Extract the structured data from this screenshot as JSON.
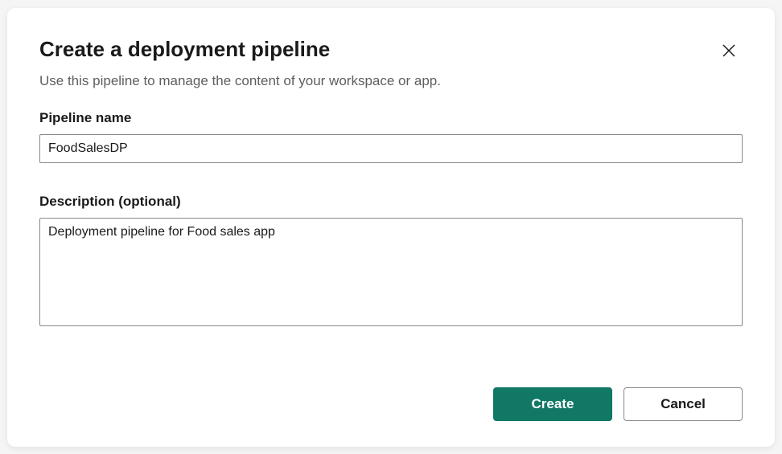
{
  "dialog": {
    "title": "Create a deployment pipeline",
    "subtitle": "Use this pipeline to manage the content of your workspace or app."
  },
  "fields": {
    "name": {
      "label": "Pipeline name",
      "value": "FoodSalesDP"
    },
    "description": {
      "label": "Description (optional)",
      "value": "Deployment pipeline for Food sales app"
    }
  },
  "buttons": {
    "create": "Create",
    "cancel": "Cancel"
  }
}
